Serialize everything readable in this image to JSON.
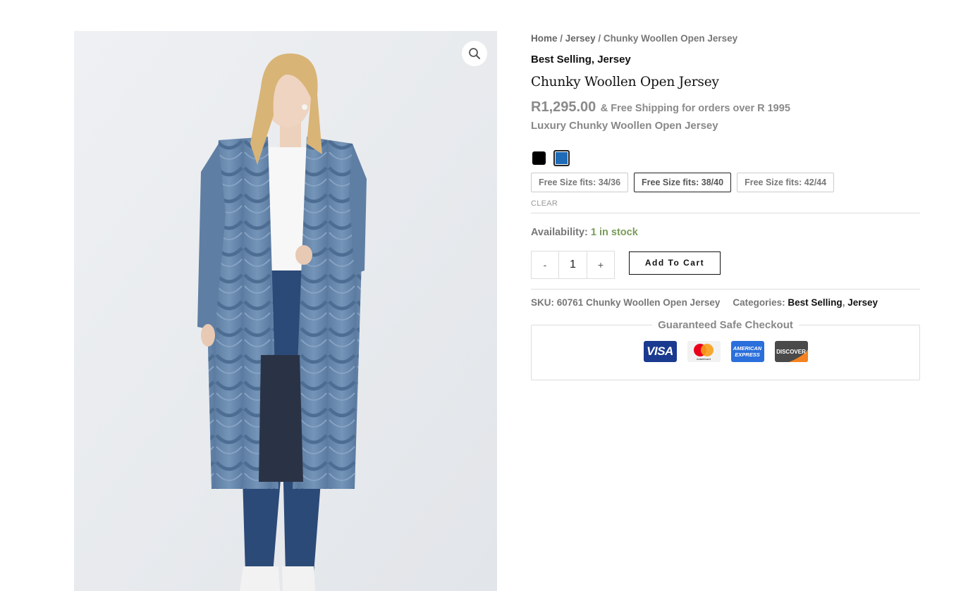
{
  "breadcrumb": {
    "home": "Home",
    "sep1": " / ",
    "category": "Jersey",
    "sep2": " / ",
    "current": "Chunky Woollen Open Jersey"
  },
  "top_categories": {
    "first": "Best Selling",
    "comma": ", ",
    "second": "Jersey"
  },
  "product": {
    "title": "Chunky Woollen Open Jersey",
    "price": "R1,295.00",
    "shipping_note": "& Free Shipping for orders over R 1995",
    "short_description": "Luxury Chunky Woollen Open Jersey"
  },
  "colors": {
    "black": "#000000",
    "blue": "#1e6bb8"
  },
  "sizes": [
    "Free Size fits: 34/36",
    "Free Size fits: 38/40",
    "Free Size fits: 42/44"
  ],
  "selected_size_index": 1,
  "clear_label": "CLEAR",
  "availability": {
    "label": "Availability:",
    "value": "1 in stock"
  },
  "quantity": {
    "minus": "-",
    "value": "1",
    "plus": "+"
  },
  "add_to_cart": "Add To Cart",
  "meta": {
    "sku_label": "SKU:",
    "sku_value": "60761 Chunky Woollen Open Jersey",
    "categories_label": "Categories:",
    "cat1": "Best Selling",
    "comma": ", ",
    "cat2": "Jersey"
  },
  "checkout": {
    "legend": "Guaranteed Safe Checkout",
    "cards": {
      "visa": "VISA",
      "mastercard": "mastercard",
      "amex_1": "AMERICAN",
      "amex_2": "EXPRESS",
      "discover": "DISCOVER"
    }
  },
  "icons": {
    "zoom": "magnifier-icon"
  }
}
